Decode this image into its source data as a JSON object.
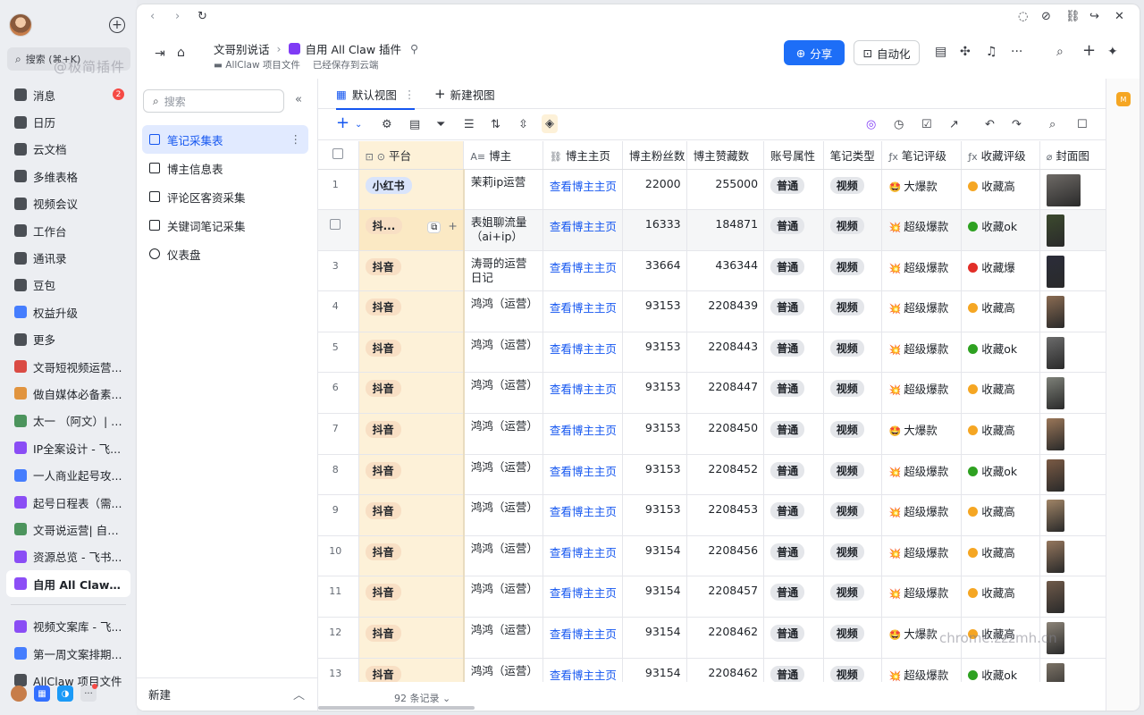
{
  "app_sidebar": {
    "search": "搜索 (⌘+K)",
    "watermark": "@极简插件",
    "nav": [
      {
        "label": "消息",
        "icon": "message-icon",
        "badge": "2",
        "color": "#3a3d44"
      },
      {
        "label": "日历",
        "icon": "calendar-icon",
        "color": "#3a3d44"
      },
      {
        "label": "云文档",
        "icon": "docs-icon",
        "color": "#3a3d44"
      },
      {
        "label": "多维表格",
        "icon": "base-icon",
        "color": "#3a3d44"
      },
      {
        "label": "视频会议",
        "icon": "video-icon",
        "color": "#3a3d44"
      },
      {
        "label": "工作台",
        "icon": "workplace-icon",
        "color": "#3a3d44"
      },
      {
        "label": "通讯录",
        "icon": "contacts-icon",
        "color": "#3a3d44"
      },
      {
        "label": "豆包",
        "icon": "doubao-icon",
        "color": "#3a3d44"
      },
      {
        "label": "权益升级",
        "icon": "diamond-icon",
        "color": "#3370ff"
      },
      {
        "label": "更多",
        "icon": "more-apps-icon",
        "color": "#3a3d44"
      },
      {
        "label": "文哥短视频运营...",
        "icon": "red-book-icon",
        "color": "#d83931"
      },
      {
        "label": "做自媒体必备素...",
        "icon": "party-icon",
        "color": "#e08a2b"
      },
      {
        "label": "太一 （阿文）| 自...",
        "icon": "books-icon",
        "color": "#3b8a4c"
      },
      {
        "label": "IP全案设计 - 飞...",
        "icon": "base-file-icon",
        "color": "#7f3bf5"
      },
      {
        "label": "一人商业起号攻...",
        "icon": "doc-file-icon",
        "color": "#3370ff"
      },
      {
        "label": "起号日程表（需...",
        "icon": "base-file-icon",
        "color": "#7f3bf5"
      },
      {
        "label": "文哥说运营| 自媒...",
        "icon": "books-icon",
        "color": "#3b8a4c"
      },
      {
        "label": "资源总览 - 飞书...",
        "icon": "base-file-icon",
        "color": "#7f3bf5"
      },
      {
        "label": "自用 All Claw 插...",
        "icon": "base-file-icon",
        "color": "#7f3bf5",
        "active": true
      }
    ],
    "nav2": [
      {
        "label": "视频文案库 - 飞...",
        "icon": "base-file-icon",
        "color": "#7f3bf5"
      },
      {
        "label": "第一周文案排期...",
        "icon": "doc-file-icon",
        "color": "#3370ff"
      },
      {
        "label": "AllClaw 项目文件",
        "icon": "folder-icon",
        "color": "#3a3d44"
      }
    ]
  },
  "header": {
    "breadcrumb_parent": "文哥别说话",
    "title": "自用 All Claw 插件",
    "folder": "AllClaw 项目文件",
    "save_status": "已经保存到云端",
    "share_label": "分享",
    "automation_label": "自动化"
  },
  "sidebar2": {
    "search_placeholder": "搜索",
    "items": [
      {
        "label": "笔记采集表",
        "active": true
      },
      {
        "label": "博主信息表"
      },
      {
        "label": "评论区客资采集"
      },
      {
        "label": "关键词笔记采集"
      },
      {
        "label": "仪表盘",
        "dashboard": true
      }
    ],
    "footer_label": "新建"
  },
  "views": {
    "default_view": "默认视图",
    "new_view": "新建视图"
  },
  "columns": [
    "平台",
    "博主",
    "博主主页",
    "博主粉丝数",
    "博主赞藏数",
    "账号属性",
    "笔记类型",
    "笔记评级",
    "收藏评级",
    "封面图"
  ],
  "rating_emoji": {
    "大爆款": "🤩",
    "超级爆款": "💥"
  },
  "collect_colors": {
    "收藏高": "#f5a623",
    "收藏ok": "#2ea121",
    "收藏爆": "#e22e28"
  },
  "rows": [
    {
      "no": "1",
      "platform": "小红书",
      "blogger": "茉莉ip运营",
      "home": "查看博主主页",
      "fans": "22000",
      "likes": "255000",
      "attr": "普通",
      "type": "视频",
      "rating": "大爆款",
      "collect": "收藏高",
      "thumb": "#6e6a66"
    },
    {
      "no": "",
      "platform": "抖...",
      "blogger": "表姐聊流量（ai+ip）",
      "home": "查看博主主页",
      "fans": "16333",
      "likes": "184871",
      "attr": "普通",
      "type": "视频",
      "rating": "超级爆款",
      "collect": "收藏ok",
      "thumb": "#3c4a2e",
      "hover": true
    },
    {
      "no": "3",
      "platform": "抖音",
      "blogger": "涛哥的运营日记",
      "home": "查看博主主页",
      "fans": "33664",
      "likes": "436344",
      "attr": "普通",
      "type": "视频",
      "rating": "超级爆款",
      "collect": "收藏爆",
      "thumb": "#2b2d3a"
    },
    {
      "no": "4",
      "platform": "抖音",
      "blogger": "鸿鸿（运营）",
      "home": "查看博主主页",
      "fans": "93153",
      "likes": "2208439",
      "attr": "普通",
      "type": "视频",
      "rating": "超级爆款",
      "collect": "收藏高",
      "thumb": "#8a6b52"
    },
    {
      "no": "5",
      "platform": "抖音",
      "blogger": "鸿鸿（运营）",
      "home": "查看博主主页",
      "fans": "93153",
      "likes": "2208443",
      "attr": "普通",
      "type": "视频",
      "rating": "超级爆款",
      "collect": "收藏ok",
      "thumb": "#6b6b6b"
    },
    {
      "no": "6",
      "platform": "抖音",
      "blogger": "鸿鸿（运营）",
      "home": "查看博主主页",
      "fans": "93153",
      "likes": "2208447",
      "attr": "普通",
      "type": "视频",
      "rating": "超级爆款",
      "collect": "收藏高",
      "thumb": "#7d8078"
    },
    {
      "no": "7",
      "platform": "抖音",
      "blogger": "鸿鸿（运营）",
      "home": "查看博主主页",
      "fans": "93153",
      "likes": "2208450",
      "attr": "普通",
      "type": "视频",
      "rating": "大爆款",
      "collect": "收藏高",
      "thumb": "#9a7658"
    },
    {
      "no": "8",
      "platform": "抖音",
      "blogger": "鸿鸿（运营）",
      "home": "查看博主主页",
      "fans": "93153",
      "likes": "2208452",
      "attr": "普通",
      "type": "视频",
      "rating": "超级爆款",
      "collect": "收藏ok",
      "thumb": "#7a5a44"
    },
    {
      "no": "9",
      "platform": "抖音",
      "blogger": "鸿鸿（运营）",
      "home": "查看博主主页",
      "fans": "93153",
      "likes": "2208453",
      "attr": "普通",
      "type": "视频",
      "rating": "超级爆款",
      "collect": "收藏高",
      "thumb": "#a08466"
    },
    {
      "no": "10",
      "platform": "抖音",
      "blogger": "鸿鸿（运营）",
      "home": "查看博主主页",
      "fans": "93154",
      "likes": "2208456",
      "attr": "普通",
      "type": "视频",
      "rating": "超级爆款",
      "collect": "收藏高",
      "thumb": "#94765d"
    },
    {
      "no": "11",
      "platform": "抖音",
      "blogger": "鸿鸿（运营）",
      "home": "查看博主主页",
      "fans": "93154",
      "likes": "2208457",
      "attr": "普通",
      "type": "视频",
      "rating": "超级爆款",
      "collect": "收藏高",
      "thumb": "#6f5a4a"
    },
    {
      "no": "12",
      "platform": "抖音",
      "blogger": "鸿鸿（运营）",
      "home": "查看博主主页",
      "fans": "93154",
      "likes": "2208462",
      "attr": "普通",
      "type": "视频",
      "rating": "大爆款",
      "collect": "收藏高",
      "thumb": "#8c8478"
    },
    {
      "no": "13",
      "platform": "抖音",
      "blogger": "鸿鸿（运营）",
      "home": "查看博主主页",
      "fans": "93154",
      "likes": "2208462",
      "attr": "普通",
      "type": "视频",
      "rating": "超级爆款",
      "collect": "收藏ok",
      "thumb": "#7b7266"
    }
  ],
  "footer": {
    "record_count": "92 条记录",
    "watermark": "chrome.zzzmh.cn"
  }
}
